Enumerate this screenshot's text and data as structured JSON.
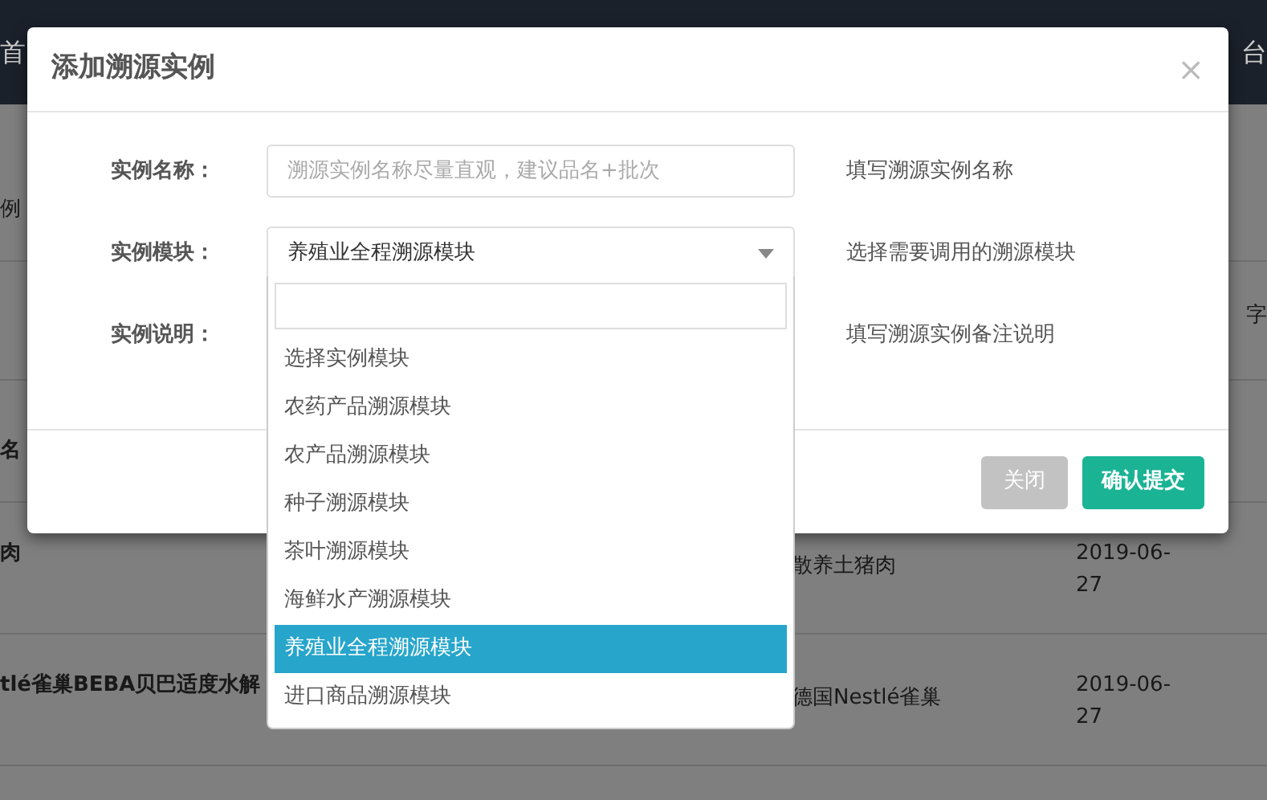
{
  "background": {
    "navbar": {
      "left_text": "首",
      "right_text": "台"
    },
    "rows": [
      {
        "left": "例",
        "right": ""
      },
      {
        "left": "",
        "right": "字"
      },
      {
        "left": "名",
        "right": ""
      }
    ],
    "table_rows": [
      {
        "name": "肉",
        "origin": "散养土猪肉",
        "date": "2019-06-27"
      },
      {
        "name": "tlé雀巢BEBA贝巴适度水解",
        "origin": "德国Nestlé雀巢",
        "date": "2019-06-27"
      }
    ]
  },
  "modal": {
    "title": "添加溯源实例",
    "close": "×",
    "fields": [
      {
        "kind": "input",
        "label": "实例名称：",
        "placeholder": "溯源实例名称尽量直观，建议品名+批次",
        "help": "填写溯源实例名称"
      },
      {
        "kind": "select",
        "label": "实例模块：",
        "value": "养殖业全程溯源模块",
        "help": "选择需要调用的溯源模块"
      },
      {
        "kind": "text",
        "label": "实例说明：",
        "help": "填写溯源实例备注说明"
      }
    ],
    "buttons": [
      {
        "label": "关闭",
        "kind": "secondary"
      },
      {
        "label": "确认提交",
        "kind": "primary"
      }
    ]
  },
  "dropdown": {
    "options": [
      {
        "label": "选择实例模块",
        "selected": false
      },
      {
        "label": "农药产品溯源模块",
        "selected": false
      },
      {
        "label": "农产品溯源模块",
        "selected": false
      },
      {
        "label": "种子溯源模块",
        "selected": false
      },
      {
        "label": "茶叶溯源模块",
        "selected": false
      },
      {
        "label": "海鲜水产溯源模块",
        "selected": false
      },
      {
        "label": "养殖业全程溯源模块",
        "selected": true
      },
      {
        "label": "进口商品溯源模块",
        "selected": false
      }
    ]
  }
}
